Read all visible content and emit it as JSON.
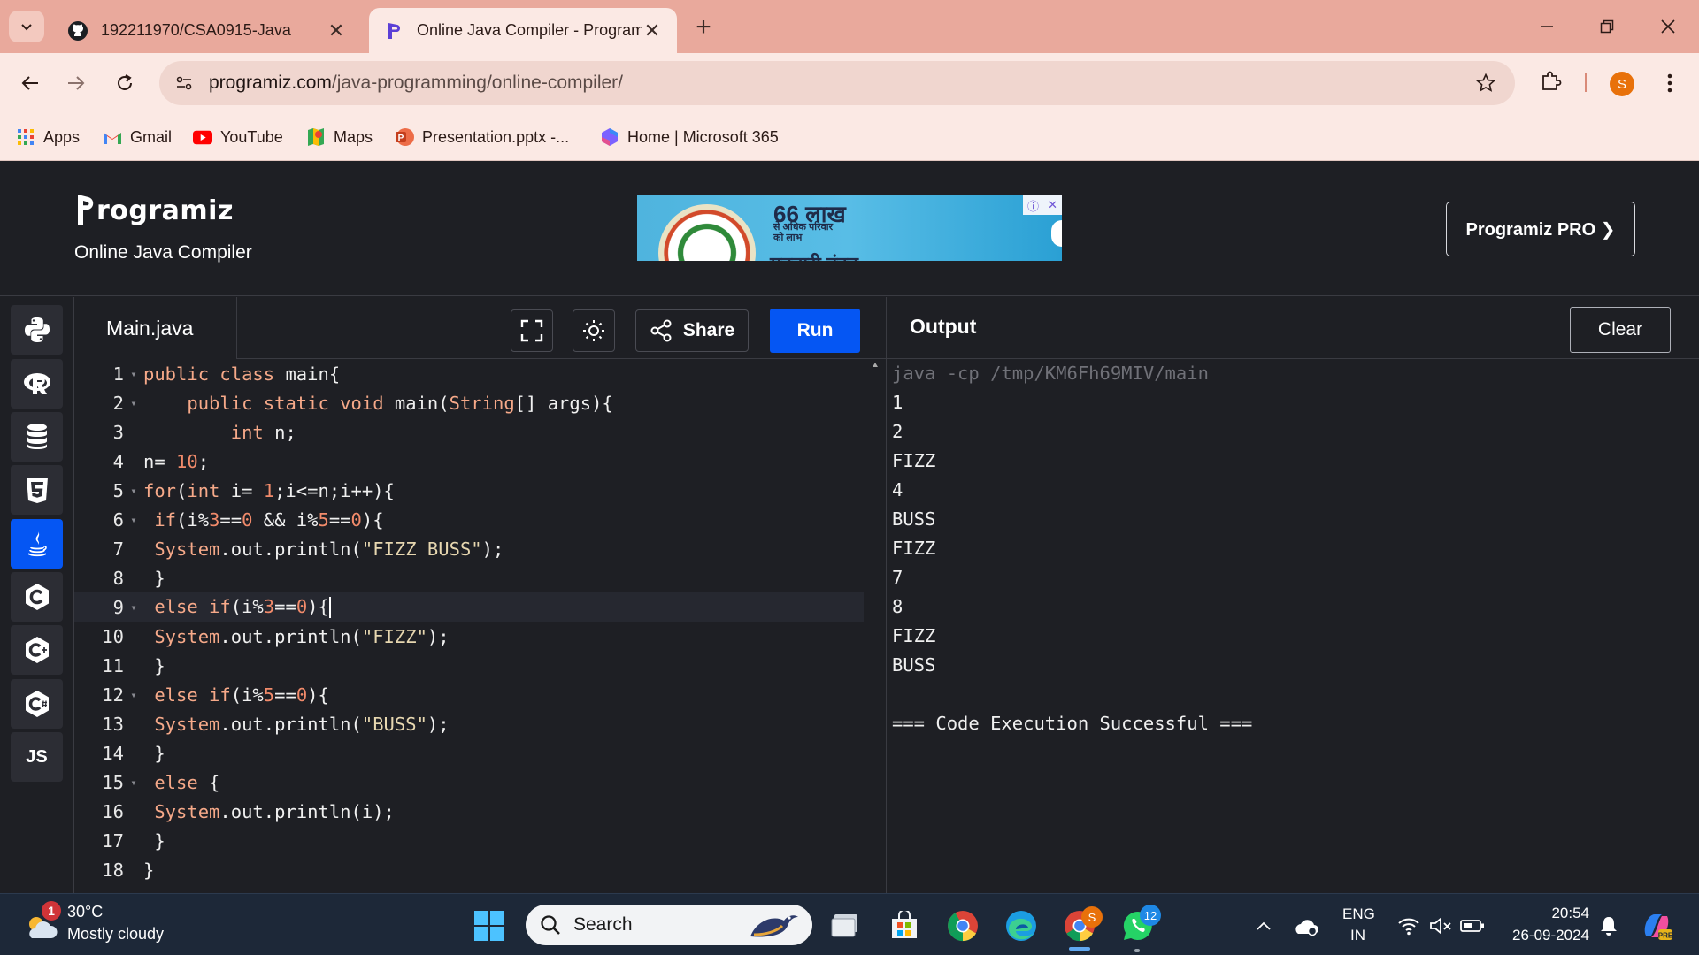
{
  "browser": {
    "tabs": [
      {
        "title": "192211970/CSA0915-Java",
        "icon": "github-icon",
        "active": false
      },
      {
        "title": "Online Java Compiler - Programiz",
        "icon": "programiz-icon",
        "active": true
      }
    ],
    "url_host": "programiz.com",
    "url_path": "/java-programming/online-compiler/",
    "profile_initial": "S",
    "bookmarks": [
      {
        "label": "Apps",
        "icon": "apps-grid-icon"
      },
      {
        "label": "Gmail",
        "icon": "gmail-icon"
      },
      {
        "label": "YouTube",
        "icon": "youtube-icon"
      },
      {
        "label": "Maps",
        "icon": "maps-icon"
      },
      {
        "label": "Presentation.pptx -...",
        "icon": "powerpoint-icon"
      },
      {
        "label": "Home | Microsoft 365",
        "icon": "microsoft365-icon"
      }
    ]
  },
  "site": {
    "logo_text": "rogramiz",
    "subtitle": "Online Java Compiler",
    "ad": {
      "big": "66 लाख",
      "small": "से अधिक परिवार को लाभ",
      "bottom": "महतारी वंदन"
    },
    "pro_button": "Programiz PRO ❯"
  },
  "sidebar": {
    "languages": [
      {
        "name": "python",
        "icon": "python-icon",
        "active": false
      },
      {
        "name": "r",
        "icon": "r-icon",
        "active": false
      },
      {
        "name": "sql",
        "icon": "database-icon",
        "active": false
      },
      {
        "name": "html",
        "icon": "html5-icon",
        "active": false
      },
      {
        "name": "java",
        "icon": "java-icon",
        "active": true
      },
      {
        "name": "c",
        "icon": "c-icon",
        "active": false
      },
      {
        "name": "cpp",
        "icon": "cpp-icon",
        "active": false
      },
      {
        "name": "csharp",
        "icon": "csharp-icon",
        "active": false
      },
      {
        "name": "js",
        "label": "JS",
        "active": false
      }
    ]
  },
  "editor": {
    "file_name": "Main.java",
    "share_label": "Share",
    "run_label": "Run",
    "current_line": 9,
    "lines": [
      "public class main{",
      "    public static void main(String[] args){",
      "        int n;",
      "n= 10;",
      "for(int i= 1;i<=n;i++){",
      " if(i%3==0 && i%5==0){",
      " System.out.println(\"FIZZ BUSS\");",
      " }",
      " else if(i%3==0){",
      " System.out.println(\"FIZZ\");",
      " }",
      " else if(i%5==0){",
      " System.out.println(\"BUSS\");",
      " }",
      " else {",
      " System.out.println(i);",
      " }",
      "}"
    ]
  },
  "output": {
    "title": "Output",
    "clear_label": "Clear",
    "command": "java -cp /tmp/KM6Fh69MIV/main",
    "lines": [
      "1",
      "2",
      "FIZZ",
      "4",
      "BUSS",
      "FIZZ",
      "7",
      "8",
      "FIZZ",
      "BUSS",
      "",
      "=== Code Execution Successful ==="
    ]
  },
  "taskbar": {
    "weather_temp": "30°C",
    "weather_desc": "Mostly cloudy",
    "weather_badge": "1",
    "search_placeholder": "Search",
    "chrome_badge": "S",
    "whatsapp_badge": "12",
    "lang_primary": "ENG",
    "lang_secondary": "IN",
    "time": "20:54",
    "date": "26-09-2024"
  },
  "colors": {
    "accent": "#0556f3",
    "background": "#1e1f24",
    "tabbar": "#e9a99c"
  }
}
